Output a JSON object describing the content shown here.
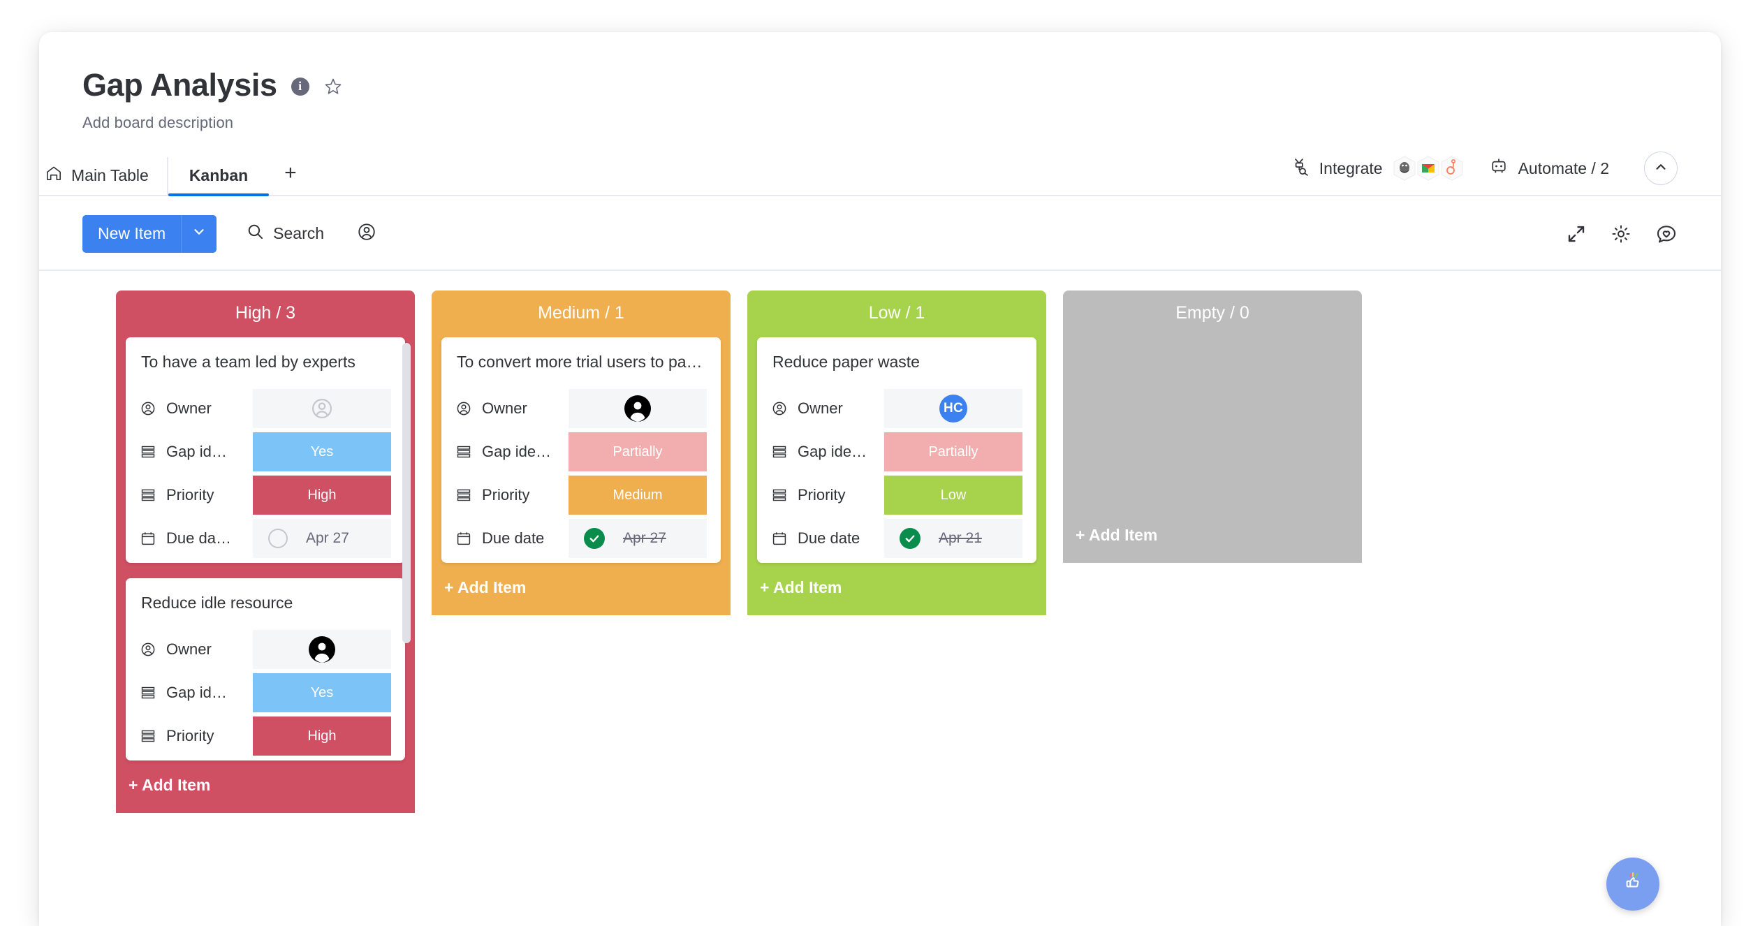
{
  "header": {
    "title": "Gap Analysis",
    "description": "Add board description",
    "info_icon": "info-icon",
    "star_icon": "star-icon"
  },
  "tabs": [
    {
      "label": "Main Table",
      "icon": "home-icon",
      "active": false
    },
    {
      "label": "Kanban",
      "icon": "",
      "active": true
    }
  ],
  "tab_add_label": "+",
  "header_actions": {
    "integrate_label": "Integrate",
    "integrate_icon": "integrate-icon",
    "integration_apps": [
      "mailchimp-icon",
      "gmail-icon",
      "hubspot-icon"
    ],
    "automate_label": "Automate / 2",
    "automate_icon": "robot-icon",
    "collapse_icon": "chevron-up-icon"
  },
  "toolbar": {
    "new_item_label": "New Item",
    "new_item_caret_icon": "chevron-down-icon",
    "search_label": "Search",
    "search_icon": "search-icon",
    "person_icon": "person-icon",
    "expand_icon": "expand-icon",
    "settings_icon": "gear-icon",
    "feedback_icon": "chat-heart-icon"
  },
  "board": {
    "add_item_label": "+ Add Item",
    "columns": [
      {
        "title": "High / 3",
        "color": "#cf4f63",
        "has_scrollbar": true,
        "cards": [
          {
            "title": "To have a team led by experts",
            "fields": [
              {
                "label": "Owner",
                "icon": "person-icon",
                "type": "avatar",
                "avatar": "placeholder",
                "value": ""
              },
              {
                "label": "Gap id…",
                "icon": "status-icon",
                "type": "chip",
                "value": "Yes",
                "color": "#7cc4f8"
              },
              {
                "label": "Priority",
                "icon": "status-icon",
                "type": "chip",
                "value": "High",
                "color": "#cf4f63"
              },
              {
                "label": "Due da…",
                "icon": "calendar-icon",
                "type": "date",
                "value": "Apr 27",
                "done": false
              }
            ]
          },
          {
            "title": "Reduce idle resource",
            "fields": [
              {
                "label": "Owner",
                "icon": "person-icon",
                "type": "avatar",
                "avatar": "dark",
                "value": ""
              },
              {
                "label": "Gap id…",
                "icon": "status-icon",
                "type": "chip",
                "value": "Yes",
                "color": "#7cc4f8"
              },
              {
                "label": "Priority",
                "icon": "status-icon",
                "type": "chip",
                "value": "High",
                "color": "#cf4f63"
              }
            ]
          }
        ]
      },
      {
        "title": "Medium / 1",
        "color": "#efaf4e",
        "has_scrollbar": false,
        "cards": [
          {
            "title": "To convert more trial users to paid/…",
            "fields": [
              {
                "label": "Owner",
                "icon": "person-icon",
                "type": "avatar",
                "avatar": "dark",
                "value": ""
              },
              {
                "label": "Gap ide…",
                "icon": "status-icon",
                "type": "chip",
                "value": "Partially",
                "color": "#f2aeae"
              },
              {
                "label": "Priority",
                "icon": "status-icon",
                "type": "chip",
                "value": "Medium",
                "color": "#efaf4e"
              },
              {
                "label": "Due date",
                "icon": "calendar-icon",
                "type": "date",
                "value": "Apr 27",
                "done": true
              }
            ]
          }
        ]
      },
      {
        "title": "Low / 1",
        "color": "#a6d24c",
        "has_scrollbar": false,
        "cards": [
          {
            "title": "Reduce paper waste",
            "fields": [
              {
                "label": "Owner",
                "icon": "person-icon",
                "type": "avatar",
                "avatar": "initials",
                "value": "HC"
              },
              {
                "label": "Gap ide…",
                "icon": "status-icon",
                "type": "chip",
                "value": "Partially",
                "color": "#f2aeae"
              },
              {
                "label": "Priority",
                "icon": "status-icon",
                "type": "chip",
                "value": "Low",
                "color": "#a6d24c"
              },
              {
                "label": "Due date",
                "icon": "calendar-icon",
                "type": "date",
                "value": "Apr 21",
                "done": true
              }
            ]
          }
        ]
      },
      {
        "title": "Empty / 0",
        "color": "#bcbcbc",
        "has_scrollbar": false,
        "cards": []
      }
    ]
  },
  "fab": {
    "icon": "thumbs-up-bubble-icon"
  }
}
